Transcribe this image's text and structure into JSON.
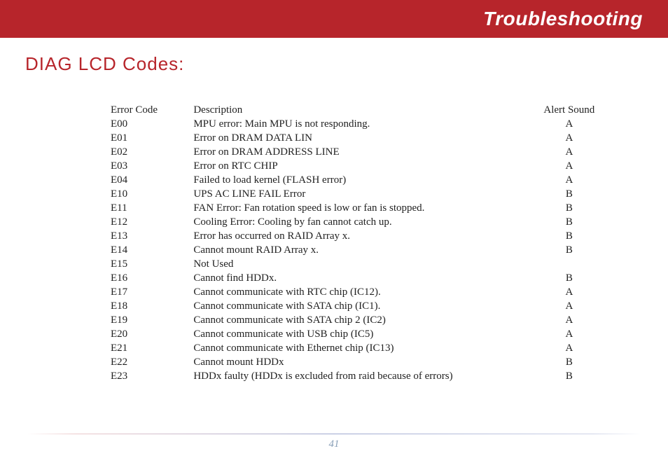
{
  "header": {
    "title": "Troubleshooting"
  },
  "section": {
    "title": "DIAG LCD Codes:"
  },
  "table": {
    "headers": {
      "code": "Error Code",
      "desc": "Description",
      "alert": "Alert Sound"
    },
    "rows": [
      {
        "code": "E00",
        "desc": "MPU error: Main MPU is not responding.",
        "alert": "A"
      },
      {
        "code": "E01",
        "desc": "Error on DRAM DATA LIN",
        "alert": "A"
      },
      {
        "code": "E02",
        "desc": "Error on DRAM ADDRESS LINE",
        "alert": "A"
      },
      {
        "code": "E03",
        "desc": "Error on RTC CHIP",
        "alert": "A"
      },
      {
        "code": "E04",
        "desc": "Failed to load kernel (FLASH error)",
        "alert": "A"
      },
      {
        "code": "E10",
        "desc": "UPS AC LINE FAIL Error",
        "alert": "B"
      },
      {
        "code": "E11",
        "desc": "FAN Error: Fan rotation speed is low or fan is stopped.",
        "alert": "B"
      },
      {
        "code": "E12",
        "desc": "Cooling Error: Cooling by fan cannot catch up.",
        "alert": "B"
      },
      {
        "code": "E13",
        "desc": "Error has occurred on RAID Array x.",
        "alert": "B"
      },
      {
        "code": "E14",
        "desc": "Cannot mount RAID Array x.",
        "alert": "B"
      },
      {
        "code": "E15",
        "desc": "Not Used",
        "alert": ""
      },
      {
        "code": "E16",
        "desc": "Cannot find HDDx.",
        "alert": "B"
      },
      {
        "code": "E17",
        "desc": "Cannot communicate with RTC chip (IC12).",
        "alert": "A"
      },
      {
        "code": "E18",
        "desc": "Cannot communicate with SATA chip (IC1).",
        "alert": "A"
      },
      {
        "code": "E19",
        "desc": "Cannot communicate with SATA chip 2 (IC2)",
        "alert": "A"
      },
      {
        "code": "E20",
        "desc": "Cannot communicate with USB chip (IC5)",
        "alert": "A"
      },
      {
        "code": "E21",
        "desc": "Cannot communicate with Ethernet chip (IC13)",
        "alert": "A"
      },
      {
        "code": "E22",
        "desc": "Cannot mount HDDx",
        "alert": "B"
      },
      {
        "code": "E23",
        "desc": "HDDx faulty (HDDx is excluded from raid because of errors)",
        "alert": "B"
      }
    ]
  },
  "footer": {
    "page": "41"
  }
}
